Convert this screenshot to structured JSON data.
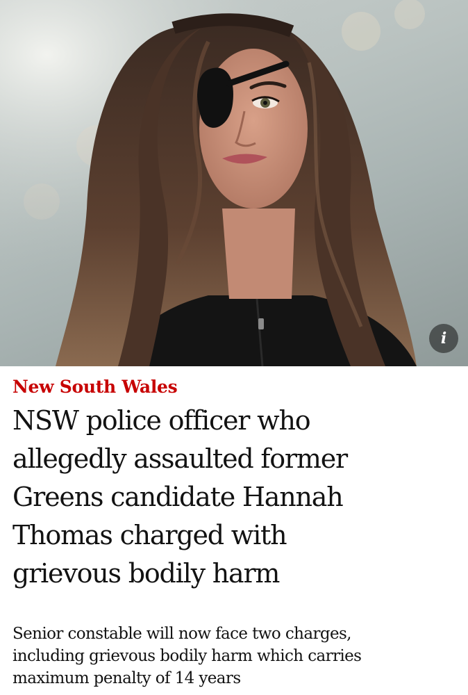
{
  "article": {
    "kicker": "New South Wales",
    "headline_lines": [
      "NSW police officer who",
      "allegedly assaulted former",
      "Greens candidate Hannah",
      "Thomas charged with",
      "grievous bodily harm"
    ],
    "standfirst_lines": [
      "Senior constable will now face two charges,",
      "including grievous bodily harm which carries",
      "maximum penalty of 14 years"
    ]
  },
  "image": {
    "info_label": "i"
  },
  "colors": {
    "kicker": "#c70000",
    "text": "#121212",
    "background": "#ffffff"
  },
  "icons": {
    "info": "info-icon"
  }
}
